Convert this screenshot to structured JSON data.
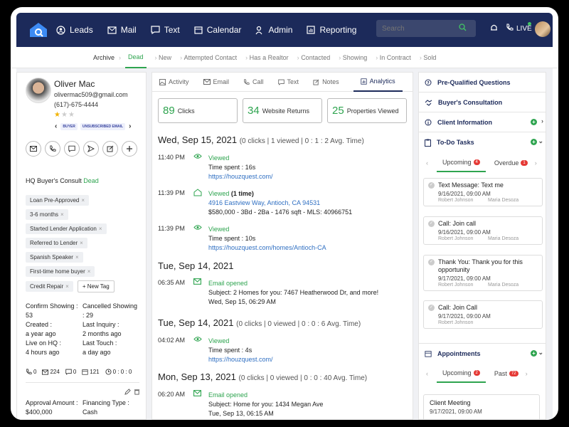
{
  "nav": {
    "items": [
      {
        "label": "Leads",
        "icon": "user-circle-icon"
      },
      {
        "label": "Mail",
        "icon": "mail-icon"
      },
      {
        "label": "Text",
        "icon": "chat-icon"
      },
      {
        "label": "Calendar",
        "icon": "calendar-icon"
      },
      {
        "label": "Admin",
        "icon": "admin-icon"
      },
      {
        "label": "Reporting",
        "icon": "chart-icon"
      }
    ],
    "search_placeholder": "Search",
    "live_label": "LIVE"
  },
  "pipeline": {
    "archive": "Archive",
    "stages": [
      "Dead",
      "New",
      "Attempted Contact",
      "Has a Realtor",
      "Contacted",
      "Showing",
      "In Contract",
      "Sold"
    ],
    "active": "Dead"
  },
  "contact": {
    "name": "Oliver Mac",
    "email": "olivermac509@gmail.com",
    "phone": "(617)-675-4444",
    "rating": 1,
    "rating_max": 3,
    "badges": [
      "BUYER",
      "UNSUBSCRIBED EMAIL"
    ],
    "consult_label": "HQ Buyer's Consult",
    "consult_status": "Dead",
    "tags": [
      "Loan Pre-Approved",
      "3-6 months",
      "Started Lender Application",
      "Referred to Lender",
      "Spanish Speaker",
      "First-time home buyer",
      "Credit Repair"
    ],
    "new_tag_label": "New Tag",
    "stats": [
      {
        "l1": "Confirm Showing :",
        "v1": "53",
        "l2": "Cancelled Showing",
        "v2": ": 29"
      },
      {
        "l1": "Created :",
        "v1": "a year ago",
        "l2": "Last Inquiry :",
        "v2": "2 months ago"
      },
      {
        "l1": "Live on HQ :",
        "v1": "4 hours ago",
        "l2": "Last Touch :",
        "v2": "a day ago"
      }
    ],
    "counts": {
      "calls": "0",
      "emails": "224",
      "texts": "0",
      "views": "121",
      "time": "0 : 0 : 0"
    },
    "approval_label": "Approval Amount :",
    "approval_value": "$400,000",
    "financing_label": "Financing Type :",
    "financing_value": "Cash"
  },
  "activity": {
    "tabs": [
      "Activity",
      "Email",
      "Call",
      "Text",
      "Notes",
      "Analytics"
    ],
    "active_tab": "Analytics",
    "metrics": [
      {
        "num": "89",
        "label": "Clicks"
      },
      {
        "num": "34",
        "label": "Website Returns"
      },
      {
        "num": "25",
        "label": "Properties Viewed"
      }
    ],
    "days": [
      {
        "date": "Wed, Sep 15, 2021",
        "summary": "(0 clicks | 1 viewed | 0 : 1 : 2 Avg. Time)"
      },
      {
        "date": "Tue, Sep 14, 2021",
        "summary": ""
      },
      {
        "date": "Tue, Sep 14, 2021",
        "summary": "(0 clicks | 0 viewed | 0 : 0 : 6 Avg. Time)"
      },
      {
        "date": "Mon, Sep 13, 2021",
        "summary": "(0 clicks | 0 viewed | 0 : 0 : 40 Avg. Time)"
      }
    ],
    "events": [
      {
        "time": "11:40 PM",
        "title": "Viewed",
        "line2": "Time spent : 16s",
        "line3": "https://houzquest.com/"
      },
      {
        "time": "11:39 PM",
        "title": "Viewed",
        "title_extra": "(1 time)",
        "line2": "4916 Eastview Way, Antioch, CA 94531",
        "line3": "$580,000 - 3Bd - 2Ba - 1476 sqft - MLS: 40966751"
      },
      {
        "time": "11:39 PM",
        "title": "Viewed",
        "line2": "Time spent : 10s",
        "line3": "https://houzquest.com/homes/Antioch-CA"
      },
      {
        "time": "06:35 AM",
        "title": "Email opened",
        "line2": "Subject: 2 Homes for you: 7467 Heatherwood Dr, and more!",
        "line3": "Wed, Sep 15, 06:29 AM"
      },
      {
        "time": "04:02 AM",
        "title": "Viewed",
        "line2": "Time spent : 4s",
        "line3": "https://houzquest.com/"
      },
      {
        "time": "06:20 AM",
        "title": "Email opened",
        "line2": "Subject: Home for you: 1434 Megan Ave",
        "line3": "Tue, Sep 13, 06:15 AM"
      }
    ]
  },
  "right": {
    "sections": [
      "Pre-Qualified Questions",
      "Buyer's Consultation",
      "Client Information",
      "To-Do Tasks",
      "Appointments"
    ],
    "todo_tabs": [
      {
        "label": "Upcoming",
        "count": "4"
      },
      {
        "label": "Overdue",
        "count": "1"
      }
    ],
    "tasks": [
      {
        "title": "Text Message: Text me",
        "date": "9/16/2021, 09:00 AM",
        "a": "Robert Johnson",
        "b": "Maria Desoza"
      },
      {
        "title": "Call: Join call",
        "date": "9/16/2021, 09:00 AM",
        "a": "Robert Johnson",
        "b": "Maria Desoza"
      },
      {
        "title": "Thank You: Thank you for this opportunity",
        "date": "9/17/2021, 09:00 AM",
        "a": "Robert Johnson",
        "b": "Maria Desoza"
      },
      {
        "title": "Call: Join Call",
        "date": "9/17/2021, 09:00 AM",
        "a": "Robert Johnson",
        "b": ""
      }
    ],
    "appt_tabs": [
      {
        "label": "Upcoming",
        "count": "2"
      },
      {
        "label": "Past",
        "count": "72"
      }
    ],
    "meeting_title": "Client Meeting",
    "meeting_date": "9/17/2021, 09:00 AM"
  },
  "colors": {
    "navy": "#1c2a5a",
    "green": "#2ea44f",
    "link": "#2f6fc2",
    "red": "#e53935",
    "star": "#f2b300"
  }
}
